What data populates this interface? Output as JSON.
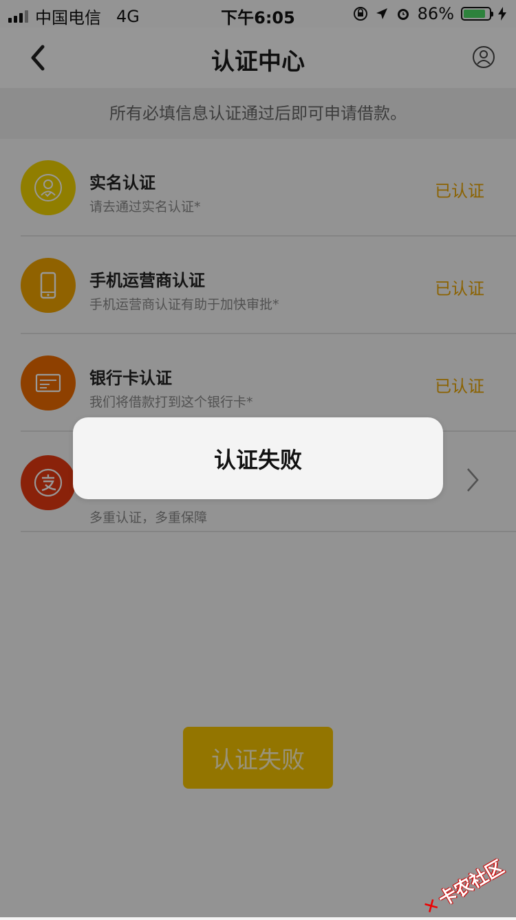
{
  "statusbar": {
    "carrier": "中国电信",
    "network": "4G",
    "time": "下午6:05",
    "battery": "86%",
    "battery_level": 0.86
  },
  "navbar": {
    "title": "认证中心"
  },
  "notice": "所有必填信息认证通过后即可申请借款。",
  "items": [
    {
      "title": "实名认证",
      "subtitle": "请去通过实名认证*",
      "status": "已认证",
      "icon": "user-icon",
      "color": "#f1d200"
    },
    {
      "title": "手机运营商认证",
      "subtitle": "手机运营商认证有助于加快审批*",
      "status": "已认证",
      "icon": "phone-icon",
      "color": "#f0a400"
    },
    {
      "title": "银行卡认证",
      "subtitle": "我们将借款打到这个银行卡*",
      "status": "已认证",
      "icon": "bank-card-icon",
      "color": "#ed6c00"
    },
    {
      "title": "",
      "subtitle": "多重认证，多重保障",
      "status": "",
      "icon": "alipay-icon",
      "color": "#e63a12"
    }
  ],
  "primary_button": "认证失败",
  "toast": "认证失败",
  "watermark": "卡农社区",
  "colors": {
    "accent_status": "#e8a400",
    "button": "#f5c400"
  }
}
